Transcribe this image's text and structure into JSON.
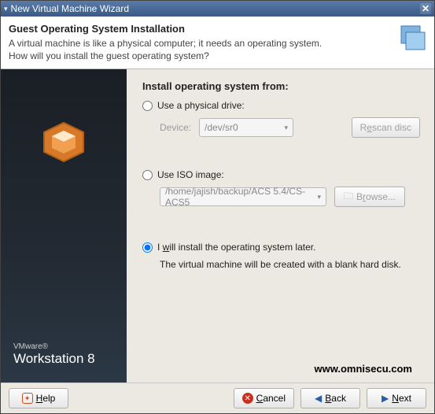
{
  "titlebar": {
    "title": "New Virtual Machine Wizard"
  },
  "header": {
    "heading": "Guest Operating System Installation",
    "desc": "A virtual machine is like a physical computer; it needs an operating system. How will you install the guest operating system?"
  },
  "sidebar": {
    "brand_small": "VMware®",
    "brand_big": "Workstation 8"
  },
  "content": {
    "heading": "Install operating system from:",
    "opt_physical": "Use a physical drive:",
    "device_label": "Device:",
    "device_value": "/dev/sr0",
    "rescan_btn": "Rescan disc",
    "opt_iso": "Use ISO image:",
    "iso_path": "/home/jajish/backup/ACS 5.4/CS-ACS5",
    "browse_btn": "Browse...",
    "opt_later": "I will install the operating system later.",
    "later_info": "The virtual machine will be created with a blank hard disk."
  },
  "watermark": "www.omnisecu.com",
  "footer": {
    "help": "Help",
    "cancel": "Cancel",
    "back": "Back",
    "next": "Next"
  }
}
